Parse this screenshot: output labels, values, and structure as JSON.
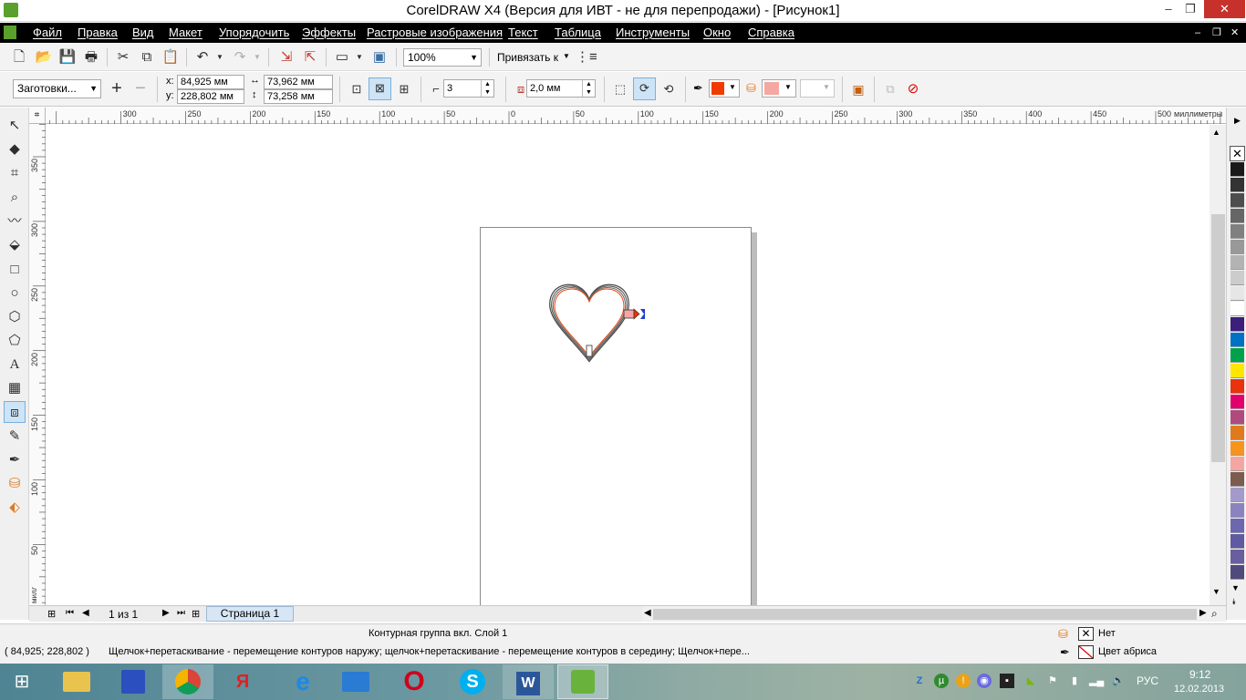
{
  "window": {
    "title": "CorelDRAW X4 (Версия для ИВТ - не для перепродажи) - [Рисунок1]",
    "minimize": "–",
    "maximize": "❐",
    "close": "✕"
  },
  "menu": {
    "items": [
      "Файл",
      "Правка",
      "Вид",
      "Макет",
      "Упорядочить",
      "Эффекты",
      "Растровые изображения",
      "Текст",
      "Таблица",
      "Инструменты",
      "Окно",
      "Справка"
    ],
    "doc_controls": [
      "–",
      "❐",
      "✕"
    ]
  },
  "toolbar": {
    "zoom_value": "100%",
    "snap_label": "Привязать к"
  },
  "propertybar": {
    "presets_value": "Заготовки...",
    "x_label": "x:",
    "y_label": "y:",
    "x_value": "84,925 мм",
    "y_value": "228,802 мм",
    "width_value": "73,962 мм",
    "height_value": "73,258 мм",
    "steps_value": "3",
    "offset_value": "2,0 мм",
    "outline_color": "#f03a00",
    "fill_color": "#f4a7a3"
  },
  "rulers": {
    "h_labels": [
      "300",
      "250",
      "200",
      "150",
      "100",
      "50",
      "0",
      "50",
      "100",
      "150",
      "200",
      "250",
      "300",
      "350",
      "400",
      "450",
      "500"
    ],
    "h_unit": "миллиметры",
    "v_labels": [
      "350",
      "300",
      "250",
      "200",
      "150",
      "100",
      "50"
    ],
    "v_unit": "миллиметры"
  },
  "palette": {
    "colors": [
      "#1a1a1a",
      "#333333",
      "#4d4d4d",
      "#666666",
      "#808080",
      "#999999",
      "#b3b3b3",
      "#cccccc",
      "#e6e6e6",
      "#ffffff",
      "#3b1f7a",
      "#0072c6",
      "#00a14b",
      "#ffe600",
      "#e8330c",
      "#e2006d",
      "#b04a7e",
      "#e07a1f",
      "#f7941d",
      "#f4a6a0",
      "#7d5b4f",
      "#a39ac9",
      "#8b82c0",
      "#6d67b0",
      "#5f5aa2",
      "#6a5f9e",
      "#4f4a7c"
    ]
  },
  "pagenav": {
    "counter": "1 из 1",
    "tab": "Страница 1"
  },
  "status": {
    "object_info": "Контурная группа вкл. Слой 1",
    "coords": "( 84,925; 228,802 )",
    "hint": "Щелчок+перетаскивание - перемещение контуров наружу; щелчок+перетаскивание - перемещение контуров в середину; Щелчок+пере...",
    "fill_label": "Нет",
    "outline_label": "Цвет абриса"
  },
  "taskbar": {
    "lang": "РУС",
    "time": "9:12",
    "date": "12.02.2013"
  }
}
